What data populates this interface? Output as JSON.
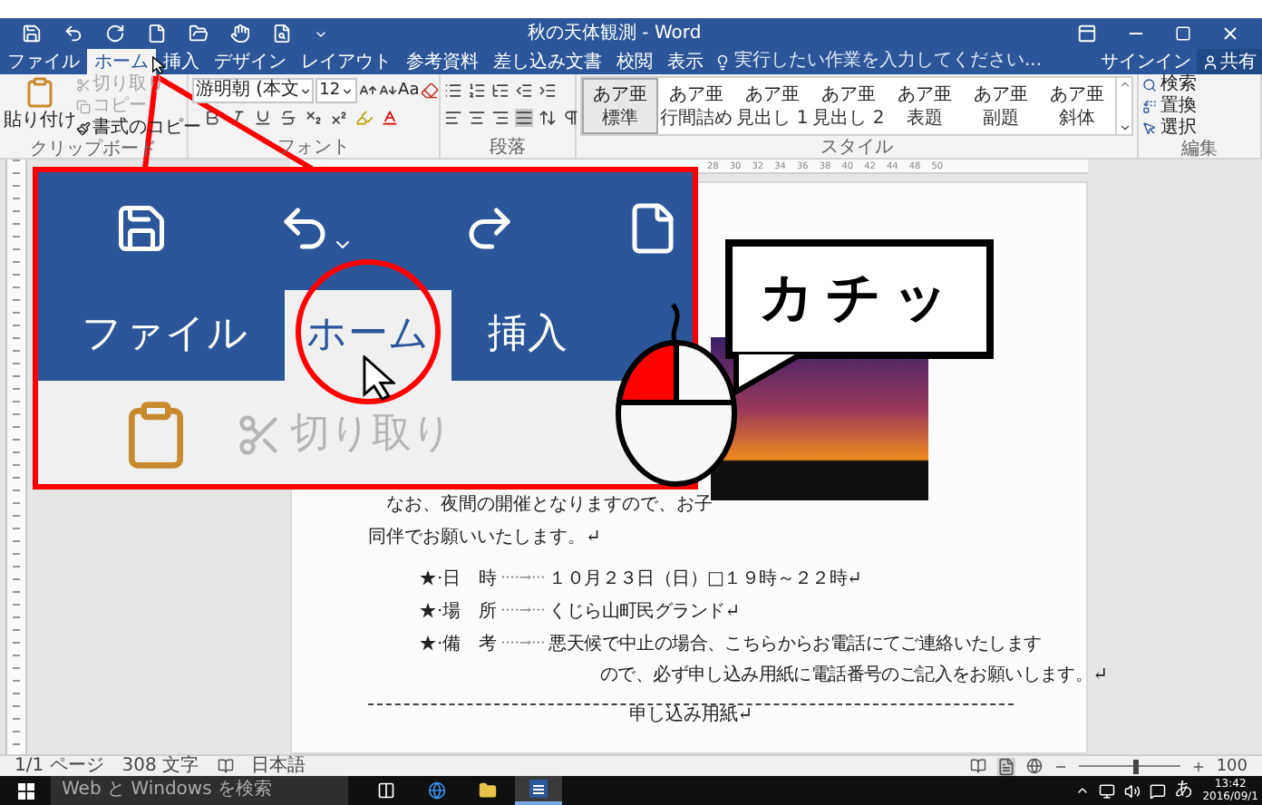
{
  "window": {
    "title": "秋の天体観測 - Word"
  },
  "tabs": [
    {
      "label": "ファイル",
      "selected": false
    },
    {
      "label": "ホーム",
      "selected": true
    },
    {
      "label": "挿入",
      "selected": false
    },
    {
      "label": "デザイン",
      "selected": false
    },
    {
      "label": "レイアウト",
      "selected": false
    },
    {
      "label": "参考資料",
      "selected": false
    },
    {
      "label": "差し込み文書",
      "selected": false
    },
    {
      "label": "校閲",
      "selected": false
    },
    {
      "label": "表示",
      "selected": false
    }
  ],
  "tell_me": {
    "placeholder": "実行したい作業を入力してください..."
  },
  "account": {
    "sign_in": "サインイン",
    "share": "共有"
  },
  "ribbon": {
    "clipboard": {
      "group": "クリップボード",
      "paste": "貼り付け",
      "items": [
        {
          "label": "切り取り",
          "disabled": true
        },
        {
          "label": "コピー",
          "disabled": true
        },
        {
          "label": "書式のコピー",
          "disabled": false
        }
      ]
    },
    "font": {
      "group": "フォント",
      "name": "游明朝 (本文",
      "size": "12",
      "change_case": "Aa"
    },
    "paragraph": {
      "group": "段落"
    },
    "styles": {
      "group": "スタイル",
      "items": [
        {
          "preview": "あア亜",
          "label": "標準",
          "selected": true
        },
        {
          "preview": "あア亜",
          "label": "行間詰め",
          "selected": false
        },
        {
          "preview": "あア亜",
          "label": "見出し 1",
          "selected": false
        },
        {
          "preview": "あア亜",
          "label": "見出し 2",
          "selected": false
        },
        {
          "preview": "あア亜",
          "label": "表題",
          "selected": false
        },
        {
          "preview": "あア亜",
          "label": "副題",
          "selected": false
        },
        {
          "preview": "あア亜",
          "label": "斜体",
          "selected": false
        }
      ]
    },
    "editing": {
      "group": "編集",
      "items": [
        "検索",
        "置換",
        "選択"
      ]
    }
  },
  "ruler": {
    "numbers": [
      "28",
      "30",
      "32",
      "34",
      "36",
      "38",
      "40",
      "42",
      "44",
      "48",
      "50"
    ]
  },
  "inset": {
    "tabs": [
      {
        "label": "ファイル",
        "selected": false
      },
      {
        "label": "ホーム",
        "selected": true
      },
      {
        "label": "挿入",
        "selected": false
      }
    ],
    "cut": {
      "label": "切り取り",
      "disabled": true
    }
  },
  "callout": {
    "text": "カチッ"
  },
  "document": {
    "paragraphs": [
      "なお、夜間の開催となりますので、お子",
      "同伴でお願いいたします。↵"
    ],
    "details": [
      {
        "label": "★·日　時",
        "leader": "····→···",
        "value": "１０月２３日（日）□１９時～２２時↵"
      },
      {
        "label": "★·場　所",
        "leader": "····→···",
        "value": "くじら山町民グランド↵"
      },
      {
        "label": "★·備　考",
        "leader": "····→···",
        "value": "悪天候で中止の場合、こちらからお電話にてご連絡いたします"
      }
    ],
    "continuation": "ので、必ず申し込み用紙に電話番号のご記入をお願いします。↵",
    "section_title": "申し込み用紙↵"
  },
  "status_bar": {
    "page": "1/1 ページ",
    "words": "308 文字",
    "language": "日本語",
    "zoom": "100",
    "zoom_slider": {
      "level": 0.55
    }
  },
  "taskbar": {
    "search": {
      "placeholder": "Web と Windows を検索"
    },
    "apps": [
      {
        "kind": "taskview",
        "selected": false
      },
      {
        "kind": "browser",
        "selected": false
      },
      {
        "kind": "folder",
        "selected": false
      },
      {
        "kind": "word",
        "selected": true
      }
    ],
    "ime": "あ",
    "time": "13:42",
    "date": "2016/09/1"
  }
}
